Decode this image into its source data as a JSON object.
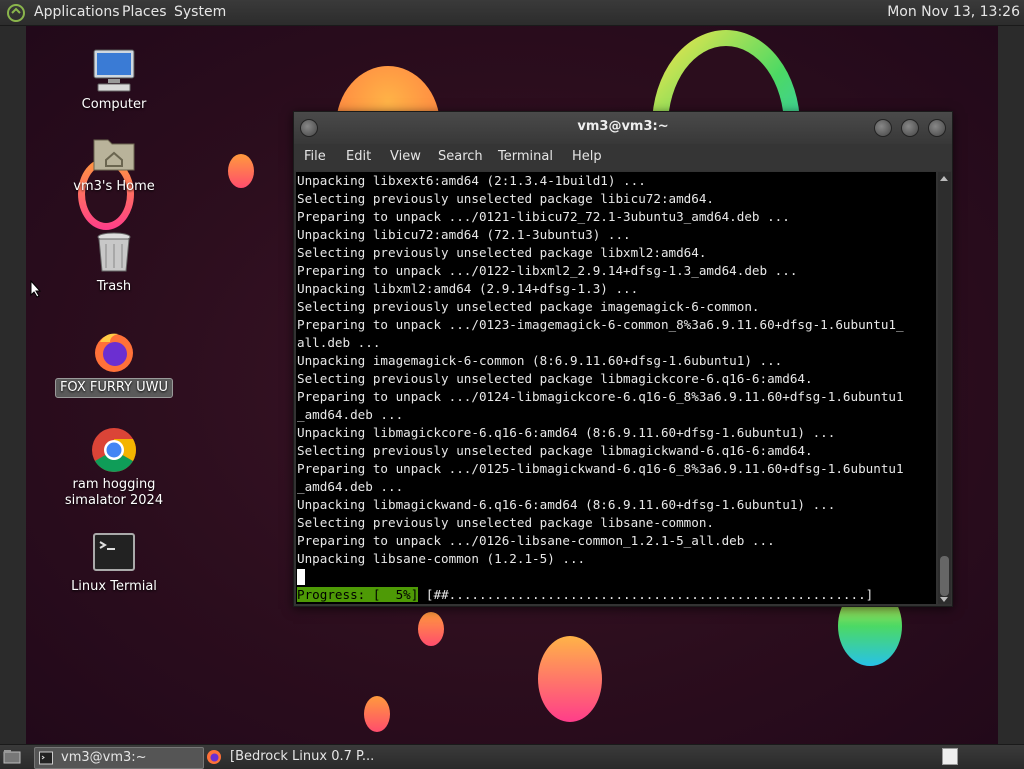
{
  "top_panel": {
    "menus": [
      "Applications",
      "Places",
      "System"
    ],
    "clock": "Mon Nov 13, 13:26"
  },
  "desktop_icons": [
    {
      "label": "Computer",
      "icon": "computer-icon"
    },
    {
      "label": "vm3's Home",
      "icon": "home-folder-icon"
    },
    {
      "label": "Trash",
      "icon": "trash-icon"
    },
    {
      "label": "FOX FURRY UWU",
      "icon": "firefox-icon"
    },
    {
      "label": "ram hogging\nsimalator 2024",
      "icon": "chrome-icon"
    },
    {
      "label": "Linux Termial",
      "icon": "terminal-icon"
    }
  ],
  "terminal": {
    "title": "vm3@vm3:~",
    "menu": [
      "File",
      "Edit",
      "View",
      "Search",
      "Terminal",
      "Help"
    ],
    "lines": [
      "Unpacking libxext6:amd64 (2:1.3.4-1build1) ...",
      "Selecting previously unselected package libicu72:amd64.",
      "Preparing to unpack .../0121-libicu72_72.1-3ubuntu3_amd64.deb ...",
      "Unpacking libicu72:amd64 (72.1-3ubuntu3) ...",
      "Selecting previously unselected package libxml2:amd64.",
      "Preparing to unpack .../0122-libxml2_2.9.14+dfsg-1.3_amd64.deb ...",
      "Unpacking libxml2:amd64 (2.9.14+dfsg-1.3) ...",
      "Selecting previously unselected package imagemagick-6-common.",
      "Preparing to unpack .../0123-imagemagick-6-common_8%3a6.9.11.60+dfsg-1.6ubuntu1_",
      "all.deb ...",
      "Unpacking imagemagick-6-common (8:6.9.11.60+dfsg-1.6ubuntu1) ...",
      "Selecting previously unselected package libmagickcore-6.q16-6:amd64.",
      "Preparing to unpack .../0124-libmagickcore-6.q16-6_8%3a6.9.11.60+dfsg-1.6ubuntu1",
      "_amd64.deb ...",
      "Unpacking libmagickcore-6.q16-6:amd64 (8:6.9.11.60+dfsg-1.6ubuntu1) ...",
      "Selecting previously unselected package libmagickwand-6.q16-6:amd64.",
      "Preparing to unpack .../0125-libmagickwand-6.q16-6_8%3a6.9.11.60+dfsg-1.6ubuntu1",
      "_amd64.deb ...",
      "Unpacking libmagickwand-6.q16-6:amd64 (8:6.9.11.60+dfsg-1.6ubuntu1) ...",
      "Selecting previously unselected package libsane-common.",
      "Preparing to unpack .../0126-libsane-common_1.2.1-5_all.deb ...",
      "Unpacking libsane-common (1.2.1-5) ..."
    ],
    "progress_label": "Progress: [  5%]",
    "progress_bar": " [##.......................................................]",
    "progress_percent": 5
  },
  "taskbar": {
    "items": [
      "vm3@vm3:~",
      "[Bedrock Linux 0.7 P..."
    ]
  },
  "colors": {
    "progress_green": "#4e9a06",
    "desktop_bg": "#2b0d1d"
  }
}
